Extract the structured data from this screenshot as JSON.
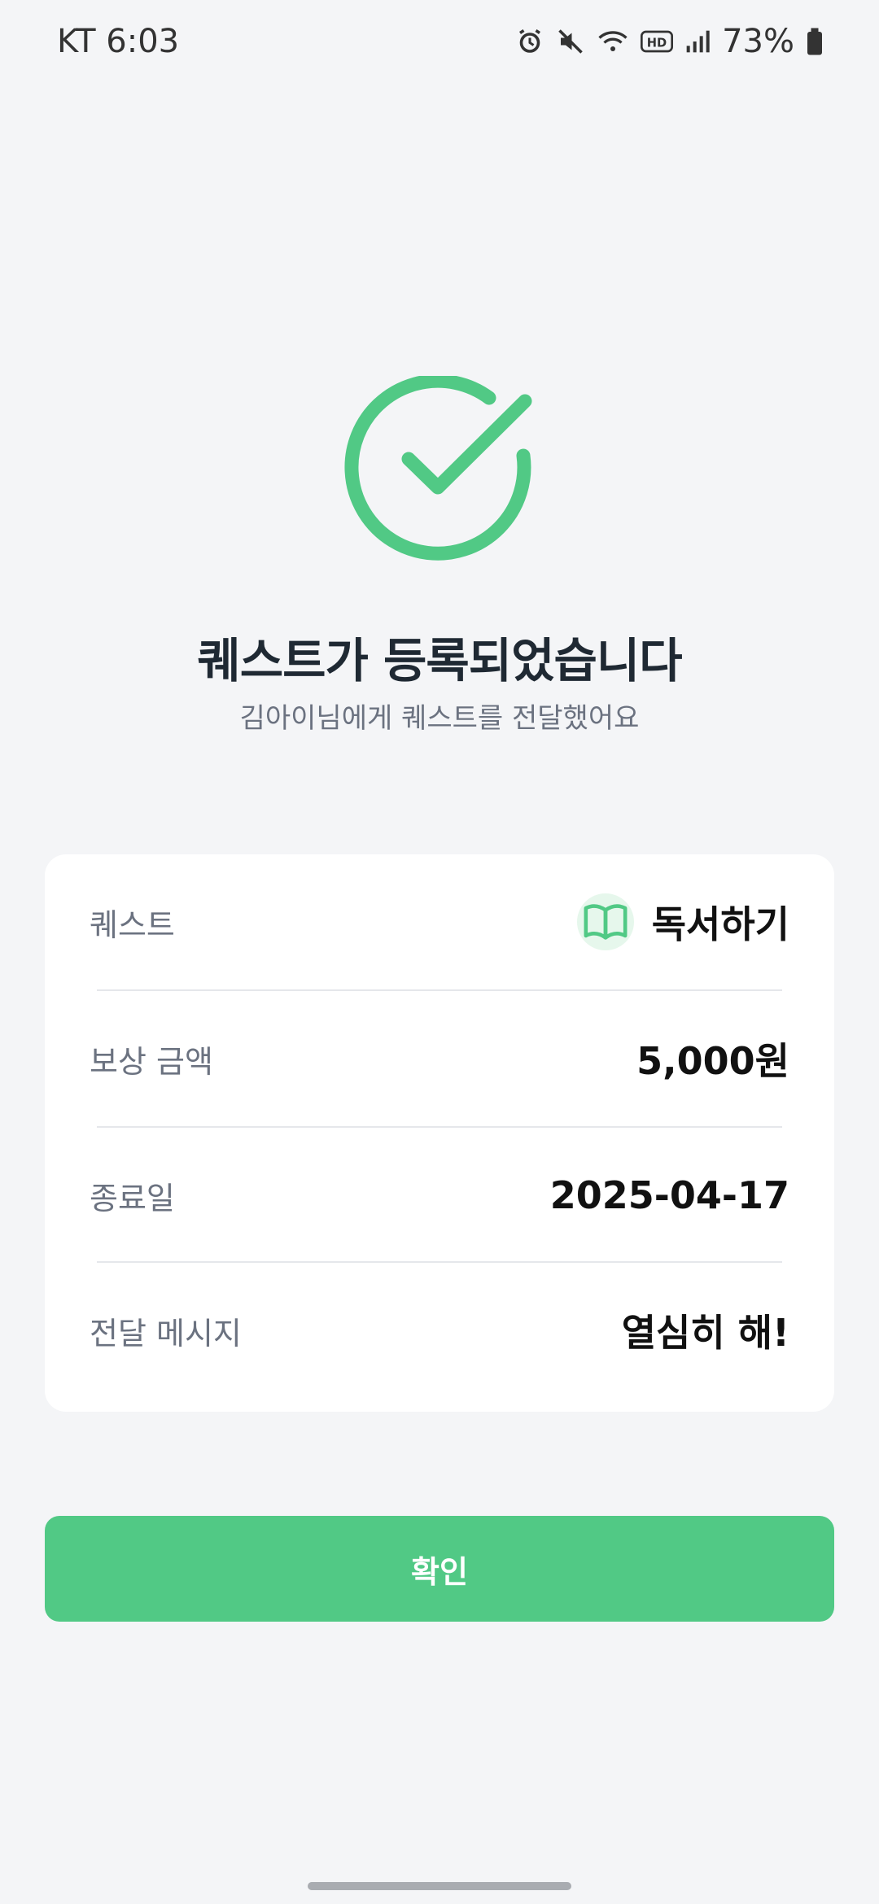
{
  "status_bar": {
    "time": "KT 6:03",
    "battery": "73%",
    "icons": [
      "alarm-icon",
      "mute-icon",
      "wifi-icon",
      "hd-icon",
      "signal-icon",
      "battery-icon"
    ]
  },
  "colors": {
    "accent": "#51c985",
    "background": "#f4f5f7"
  },
  "success": {
    "icon": "check-circle-icon",
    "title": "퀘스트가 등록되었습니다",
    "subtitle": "김아이님에게 퀘스트를 전달했어요"
  },
  "details": {
    "quest_label": "퀘스트",
    "quest_icon": "book-icon",
    "quest_value": "독서하기",
    "reward_label": "보상 금액",
    "reward_value": "5,000원",
    "end_date_label": "종료일",
    "end_date_value": "2025-04-17",
    "message_label": "전달 메시지",
    "message_value": "열심히 해!"
  },
  "actions": {
    "confirm_label": "확인"
  }
}
